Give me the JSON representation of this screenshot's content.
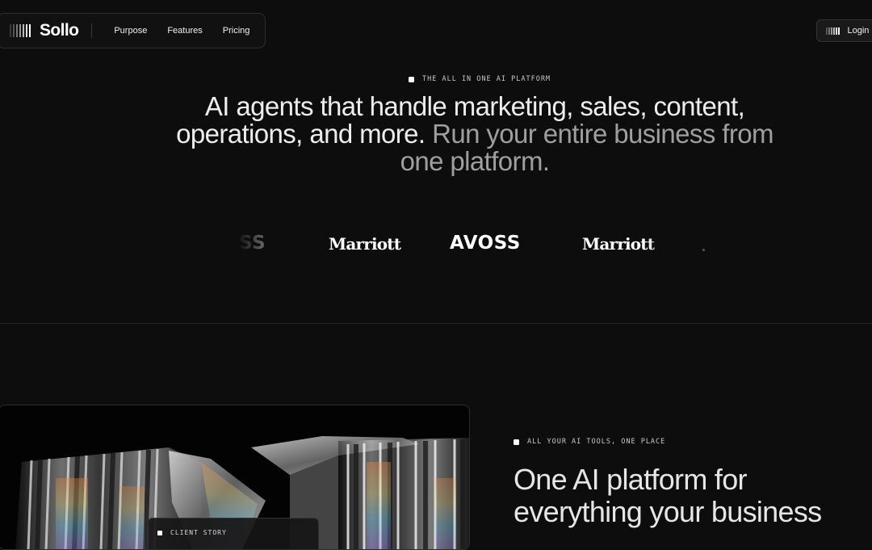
{
  "nav": {
    "brand": "Sollo",
    "brand_icon": "barcode-bars-icon",
    "links": [
      "Purpose",
      "Features",
      "Pricing"
    ],
    "login_label": "Login"
  },
  "hero": {
    "eyebrow": "THE ALL IN ONE AI PLATFORM",
    "title_primary": "AI agents that handle marketing, sales, content, operations, and more.",
    "title_secondary": "Run your entire business from one platform."
  },
  "logos": {
    "items": [
      "SS",
      "Marriott",
      "AVOSS",
      "Marriott"
    ]
  },
  "media": {
    "story_label": "CLIENT STORY",
    "image": "glass-prism-sculpture"
  },
  "feature": {
    "eyebrow": "ALL YOUR AI TOOLS, ONE PLACE",
    "title_line1": "One AI platform for",
    "title_line2": "everything your business"
  },
  "colors": {
    "background": "#0d0d0d",
    "text": "#ededed",
    "muted": "#9f9f9f",
    "accent": "#ffffff"
  }
}
